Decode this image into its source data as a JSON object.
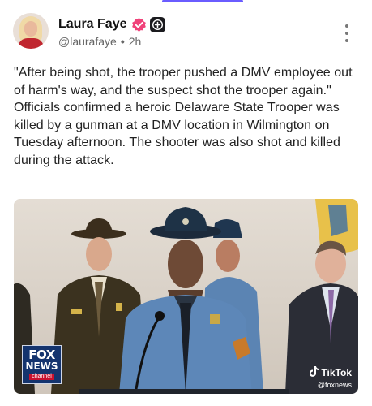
{
  "post": {
    "author": {
      "display_name": "Laura Faye",
      "handle": "@laurafaye",
      "time_ago": "2h",
      "separator": "•"
    },
    "paragraphs": [
      "\"After being shot, the trooper pushed a DMV employee out of harm's way, and the suspect shot the trooper again.\"",
      "Officials confirmed a heroic Delaware State Trooper was killed by a gunman at a DMV location in Wilmington on Tuesday afternoon. The shooter was also shot and killed during the attack."
    ],
    "media": {
      "network_logo": {
        "line1": "FOX",
        "line2": "NEWS",
        "line3": "channel"
      },
      "watermark": {
        "app": "TikTok",
        "handle": "@foxnews"
      }
    }
  },
  "icons": {
    "avatar": "avatar-photo",
    "verified": "verified-badge-icon",
    "plus": "plus-icon",
    "more": "more-vertical-icon",
    "tiktok": "tiktok-icon"
  },
  "colors": {
    "accent": "#6a5cff",
    "verified_badge": "#f0437a",
    "fox_blue": "#14346e",
    "fox_red": "#c8102e"
  }
}
